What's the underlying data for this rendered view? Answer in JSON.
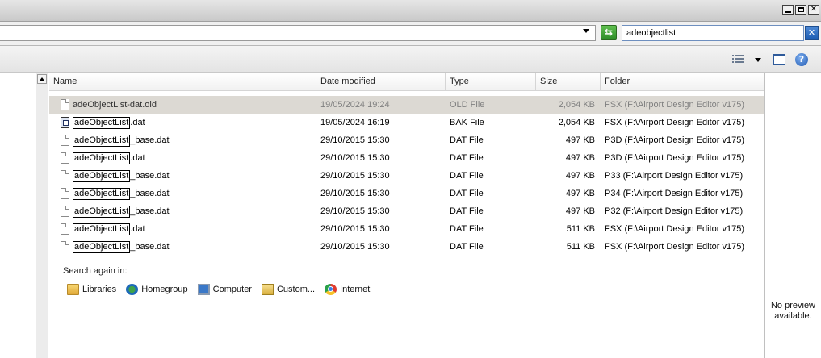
{
  "search": {
    "query": "adeobjectlist"
  },
  "filelist": {
    "columns": {
      "name": "Name",
      "date": "Date modified",
      "type": "Type",
      "size": "Size",
      "folder": "Folder"
    },
    "rows": [
      {
        "name_hl": "adeObjectList",
        "name_rest": "-dat.old",
        "date": "19/05/2024 19:24",
        "type": "OLD File",
        "size": "2,054 KB",
        "folder": "FSX (F:\\Airport Design Editor v175)",
        "icon": "file-icon",
        "selected": true
      },
      {
        "name_hl": "adeObjectList",
        "name_rest": ".dat",
        "date": "19/05/2024 16:19",
        "type": "BAK File",
        "size": "2,054 KB",
        "folder": "FSX (F:\\Airport Design Editor v175)",
        "icon": "bak-file-icon"
      },
      {
        "name_hl": "adeObjectList",
        "name_rest": "_base.dat",
        "date": "29/10/2015 15:30",
        "type": "DAT File",
        "size": "497 KB",
        "folder": "P3D (F:\\Airport Design Editor v175)",
        "icon": "file-icon"
      },
      {
        "name_hl": "adeObjectList",
        "name_rest": ".dat",
        "date": "29/10/2015 15:30",
        "type": "DAT File",
        "size": "497 KB",
        "folder": "P3D (F:\\Airport Design Editor v175)",
        "icon": "file-icon"
      },
      {
        "name_hl": "adeObjectList",
        "name_rest": "_base.dat",
        "date": "29/10/2015 15:30",
        "type": "DAT File",
        "size": "497 KB",
        "folder": "P33 (F:\\Airport Design Editor v175)",
        "icon": "file-icon"
      },
      {
        "name_hl": "adeObjectList",
        "name_rest": "_base.dat",
        "date": "29/10/2015 15:30",
        "type": "DAT File",
        "size": "497 KB",
        "folder": "P34 (F:\\Airport Design Editor v175)",
        "icon": "file-icon"
      },
      {
        "name_hl": "adeObjectList",
        "name_rest": "_base.dat",
        "date": "29/10/2015 15:30",
        "type": "DAT File",
        "size": "497 KB",
        "folder": "P32 (F:\\Airport Design Editor v175)",
        "icon": "file-icon"
      },
      {
        "name_hl": "adeObjectList",
        "name_rest": ".dat",
        "date": "29/10/2015 15:30",
        "type": "DAT File",
        "size": "511 KB",
        "folder": "FSX (F:\\Airport Design Editor v175)",
        "icon": "file-icon"
      },
      {
        "name_hl": "adeObjectList",
        "name_rest": "_base.dat",
        "date": "29/10/2015 15:30",
        "type": "DAT File",
        "size": "511 KB",
        "folder": "FSX (F:\\Airport Design Editor v175)",
        "icon": "file-icon"
      }
    ],
    "search_again_label": "Search again in:",
    "locations": [
      {
        "label": "Libraries",
        "icon": "libraries-icon"
      },
      {
        "label": "Homegroup",
        "icon": "homegroup-icon"
      },
      {
        "label": "Computer",
        "icon": "computer-icon"
      },
      {
        "label": "Custom...",
        "icon": "custom-icon"
      },
      {
        "label": "Internet",
        "icon": "internet-icon"
      }
    ]
  },
  "preview": {
    "text_line1": "No preview",
    "text_line2": "available."
  },
  "colors": {
    "selected_row": "#dcd9d3",
    "search_clear": "#1f5fb5",
    "refresh": "#2f8f2a"
  }
}
